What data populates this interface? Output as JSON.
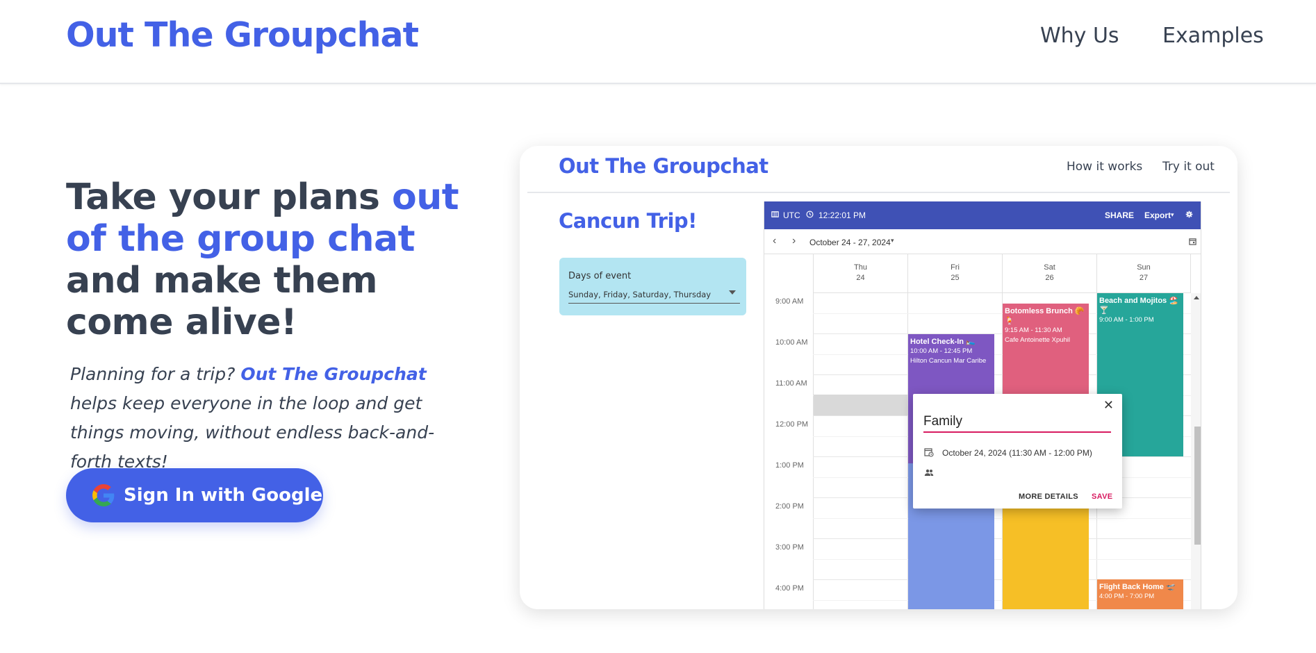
{
  "header": {
    "brand": "Out The Groupchat",
    "nav": [
      "Why Us",
      "Examples"
    ]
  },
  "hero": {
    "title_parts": [
      "Take your plans ",
      "out of the group chat",
      " and make them come alive!"
    ],
    "subtitle_parts": [
      "Planning for a trip? ",
      "Out The Groupchat",
      " helps keep everyone in the loop and get things moving, without endless back-and-forth texts!"
    ],
    "signin_label": "Sign In with Google"
  },
  "preview": {
    "brand": "Out The Groupchat",
    "nav": [
      "How it works",
      "Try it out"
    ],
    "trip_title": "Cancun Trip!",
    "days_field": {
      "label": "Days of event",
      "value": "Sunday, Friday, Saturday, Thursday"
    },
    "calendar": {
      "timezone": "UTC",
      "clock": "12:22:01 PM",
      "share_label": "SHARE",
      "export_label": "Export",
      "date_range": "October 24 - 27, 2024",
      "days": [
        {
          "name": "Thu",
          "num": "24"
        },
        {
          "name": "Fri",
          "num": "25"
        },
        {
          "name": "Sat",
          "num": "26"
        },
        {
          "name": "Sun",
          "num": "27"
        }
      ],
      "times": [
        "9:00 AM",
        "10:00 AM",
        "11:00 AM",
        "12:00 PM",
        "1:00 PM",
        "2:00 PM",
        "3:00 PM",
        "4:00 PM"
      ],
      "events": [
        {
          "title": "Hotel Check-In 🛌",
          "time": "10:00 AM - 12:45 PM",
          "place": "Hilton Cancun Mar Caribe",
          "color": "#7e57c2"
        },
        {
          "title": "Botomless Brunch 🥐🍹",
          "time": "9:15 AM - 11:30 AM",
          "place": "Cafe Antoinette Xpuhil",
          "color": "#e0607e"
        },
        {
          "title": "Beach and Mojitos 🏖️🍸",
          "time": "9:00 AM - 1:00 PM",
          "place": "",
          "color": "#26a69a"
        },
        {
          "title": "Flight Back Home 🛫",
          "time": "4:00 PM - 7:00 PM",
          "place": "",
          "color": "#f0884a"
        },
        {
          "title": "",
          "time": "",
          "place": "",
          "color": "#7b97e6"
        },
        {
          "title": "",
          "time": "",
          "place": "",
          "color": "#f6bf26"
        }
      ],
      "popup": {
        "input_value": "Family",
        "date_text": "October 24, 2024 (11:30 AM - 12:00 PM)",
        "more_label": "MORE DETAILS",
        "save_label": "SAVE"
      }
    }
  },
  "colors": {
    "brand_blue": "#4361e6",
    "scheduler_bar": "#3f51b5",
    "save_pink": "#d81b60",
    "days_box": "#b3e5f2"
  }
}
